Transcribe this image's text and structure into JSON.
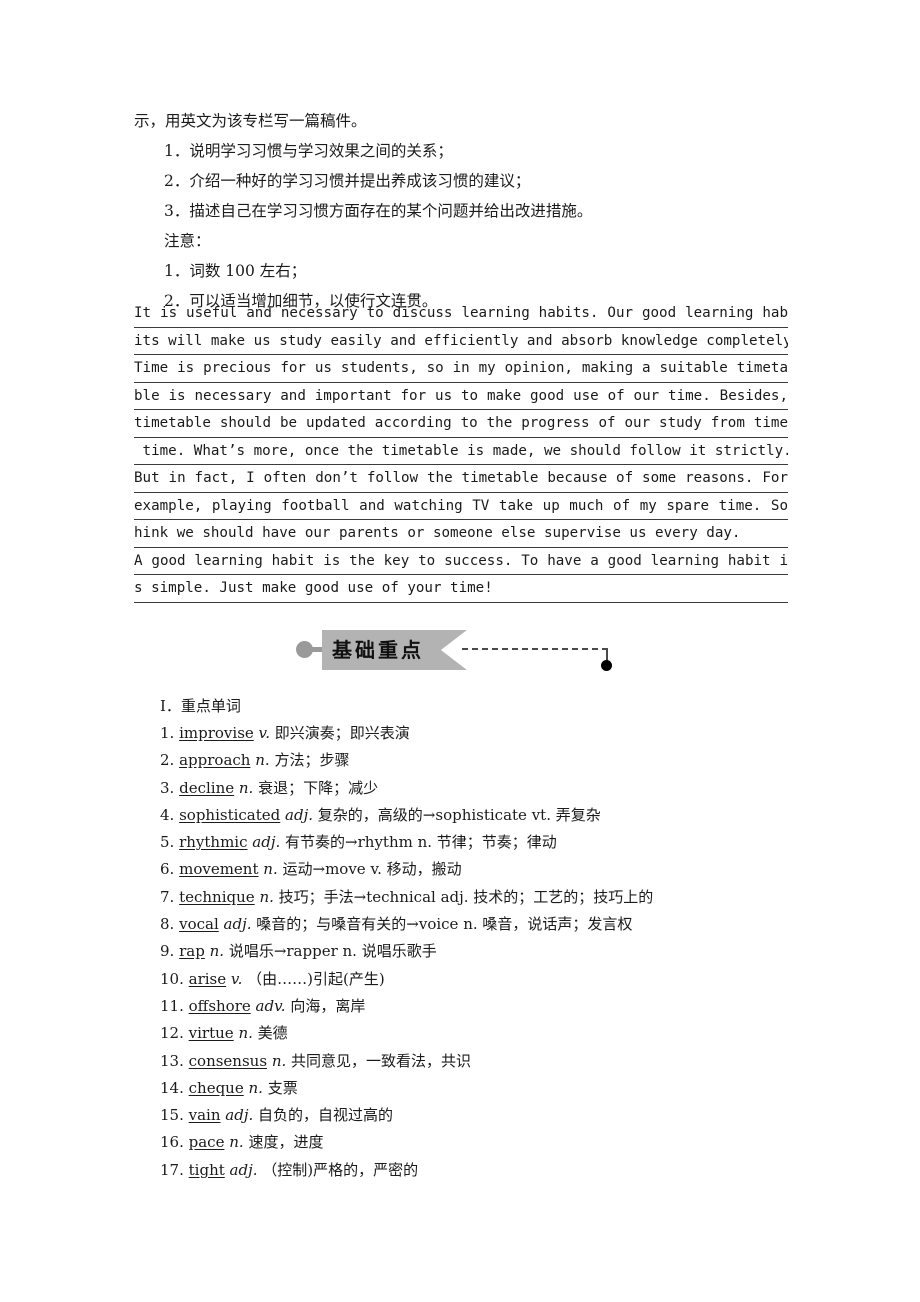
{
  "prompt": {
    "lines": [
      {
        "text": "示，用英文为该专栏写一篇稿件。",
        "indent": false
      },
      {
        "text": "1．说明学习习惯与学习效果之间的关系；",
        "indent": true
      },
      {
        "text": "2．介绍一种好的学习习惯并提出养成该习惯的建议；",
        "indent": true
      },
      {
        "text": "3．描述自己在学习习惯方面存在的某个问题并给出改进措施。",
        "indent": true
      },
      {
        "text": "注意：",
        "indent": true
      },
      {
        "text": "1．词数 100 左右；",
        "indent": true
      },
      {
        "text": "2．可以适当增加细节，以使行文连贯。",
        "indent": true
      }
    ]
  },
  "essay": {
    "lines": [
      {
        "text": "    It is useful and necessary to discuss learning habits. Our good learning hab",
        "justify": true
      },
      {
        "text": "its will make us study easily and efficiently and absorb knowledge completely.",
        "justify": false
      },
      {
        "text": "    Time is precious for us students, so in my opinion, making a suitable timeta",
        "justify": true
      },
      {
        "text": "ble is necessary and important for us to make good use of our time. Besides, the",
        "justify": true
      },
      {
        "text": " timetable should be updated according to the progress of our study from time to",
        "justify": true
      },
      {
        "text": " time. What’s more, once the timetable is made, we should follow it strictly.",
        "justify": false
      },
      {
        "text": "    But in fact, I often don’t follow the timetable because of some reasons. For",
        "justify": true
      },
      {
        "text": " example, playing football and watching TV take up much of my spare time. So I t",
        "justify": true
      },
      {
        "text": "hink we should have our parents or someone else supervise us every day.",
        "justify": false
      },
      {
        "text": "    A good learning habit is the key to success. To have a good learning habit i",
        "justify": true
      },
      {
        "text": "s simple. Just make good use of your time!",
        "justify": false
      }
    ]
  },
  "banner": {
    "title": "基础重点",
    "ribbon_color": "#b3b3b3",
    "dot_color": "#9a9a9a",
    "line_color": "#4a4a4a",
    "end_dot_color": "#000000"
  },
  "vocab": {
    "heading": "Ⅰ．重点单词",
    "items": [
      {
        "num": "1.",
        "word": "improvise",
        "pos": "v.",
        "def": "即兴演奏；即兴表演"
      },
      {
        "num": "2.",
        "word": "approach",
        "pos": "n.",
        "def": "方法；步骤"
      },
      {
        "num": "3.",
        "word": "decline",
        "pos": "n.",
        "def": "衰退；下降；减少"
      },
      {
        "num": "4.",
        "word": "sophisticated",
        "pos": "adj.",
        "def": "复杂的，高级的→sophisticate vt. 弄复杂"
      },
      {
        "num": "5.",
        "word": "rhythmic",
        "pos": "adj.",
        "def": "有节奏的→rhythm n. 节律；节奏；律动"
      },
      {
        "num": "6.",
        "word": "movement",
        "pos": "n.",
        "def": "运动→move v. 移动，搬动"
      },
      {
        "num": "7.",
        "word": "technique",
        "pos": "n.",
        "def": "技巧；手法→technical adj. 技术的；工艺的；技巧上的"
      },
      {
        "num": "8.",
        "word": "vocal",
        "pos": "adj.",
        "def": "嗓音的；与嗓音有关的→voice n. 嗓音，说话声；发言权"
      },
      {
        "num": "9.",
        "word": "rap",
        "pos": "n.",
        "def": "说唱乐→rapper n. 说唱乐歌手"
      },
      {
        "num": "10.",
        "word": "arise",
        "pos": "v.",
        "def": "（由……)引起(产生)"
      },
      {
        "num": "11.",
        "word": "offshore",
        "pos": "adv.",
        "def": "向海，离岸"
      },
      {
        "num": "12.",
        "word": "virtue",
        "pos": "n.",
        "def": "美德"
      },
      {
        "num": "13.",
        "word": "consensus",
        "pos": "n.",
        "def": "共同意见，一致看法，共识"
      },
      {
        "num": "14.",
        "word": "cheque",
        "pos": "n.",
        "def": "支票"
      },
      {
        "num": "15.",
        "word": "vain",
        "pos": "adj.",
        "def": "自负的，自视过高的"
      },
      {
        "num": "16.",
        "word": "pace",
        "pos": "n.",
        "def": "速度，进度"
      },
      {
        "num": "17.",
        "word": "tight",
        "pos": "adj.",
        "def": "（控制)严格的，严密的"
      }
    ]
  }
}
